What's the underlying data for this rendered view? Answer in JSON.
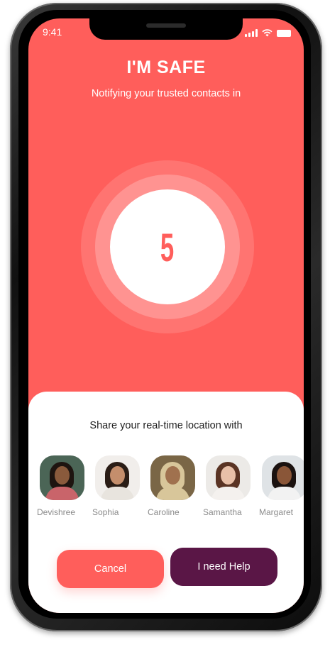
{
  "status_bar": {
    "time": "9:41"
  },
  "header": {
    "title": "I'M SAFE",
    "subtitle": "Notifying your trusted contacts in"
  },
  "countdown": {
    "value": "5"
  },
  "share_sheet": {
    "title": "Share your real-time location with",
    "contacts": [
      {
        "name": "Devishree",
        "avatar_bg": "#4b6556",
        "hair": "#1e1410",
        "skin": "#8a5a3c",
        "clothes": "#c9646a"
      },
      {
        "name": "Sophia",
        "avatar_bg": "#f1eeeb",
        "hair": "#2a1d16",
        "skin": "#c48e6c",
        "clothes": "#e8e4de"
      },
      {
        "name": "Caroline",
        "avatar_bg": "#7a6646",
        "hair": "#d8c69a",
        "skin": "#a0714e",
        "clothes": "#d8c69a"
      },
      {
        "name": "Samantha",
        "avatar_bg": "#eceae7",
        "hair": "#5a3424",
        "skin": "#e8c0a8",
        "clothes": "#f4f1ee"
      },
      {
        "name": "Margaret",
        "avatar_bg": "#dfe3e6",
        "hair": "#1a1210",
        "skin": "#8a5638",
        "clothes": "#f2f2f2"
      }
    ]
  },
  "actions": {
    "cancel_label": "Cancel",
    "help_label": "I need Help"
  },
  "colors": {
    "accent": "#ff5e5b",
    "help_button": "#5a1646"
  }
}
